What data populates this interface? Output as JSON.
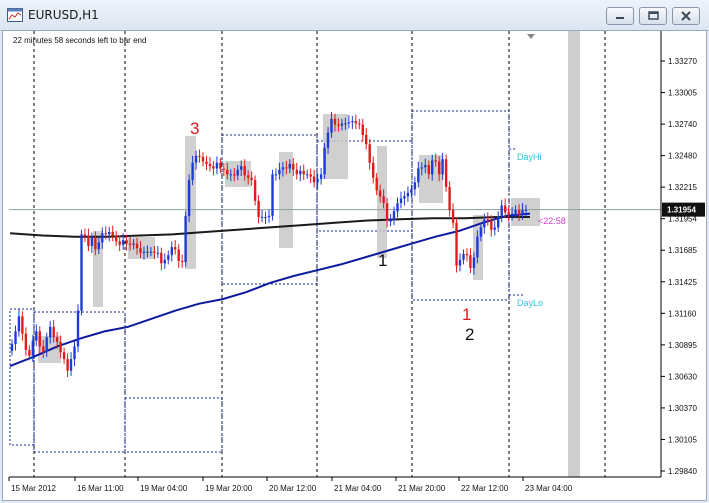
{
  "window": {
    "title": "EURUSD,H1",
    "icon": "chart-window-icon",
    "controls": [
      "minimize-icon",
      "restore-icon",
      "close-icon"
    ]
  },
  "chart_data": {
    "type": "candlestick",
    "symbol": "EURUSD",
    "timeframe": "H1",
    "info_text": "22 minutes 58 seconds left to bar end",
    "ylim": [
      1.2964,
      1.335
    ],
    "y_ticks": [
      "1.33270",
      "1.33005",
      "1.32740",
      "1.32480",
      "1.32215",
      "1.31954",
      "1.31685",
      "1.31425",
      "1.31160",
      "1.30895",
      "1.30630",
      "1.30370",
      "1.30105",
      "1.29840"
    ],
    "current_price": "1.31954",
    "x_ticks": [
      "15 Mar 2012",
      "16 Mar 11:00",
      "19 Mar 04:00",
      "19 Mar 20:00",
      "20 Mar 12:00",
      "21 Mar 04:00",
      "21 Mar 20:00",
      "22 Mar 12:00",
      "23 Mar 04:00"
    ],
    "labels": {
      "day_hi": "DayHi",
      "day_lo": "DayLo",
      "countdown": "<22:58",
      "wave_3": "3",
      "wave_1_black": "1",
      "wave_1_red": "1",
      "wave_2": "2"
    },
    "colors": {
      "bull": "#1f3ad8",
      "bear": "#e01b1b",
      "ma_fast": "#0c1a9e",
      "ma_slow": "#1a1a1a",
      "box": "#c8c8c8",
      "dayhilo": "#29c7de",
      "countdown": "#d23cd2",
      "price_line": "#8aa0a0"
    },
    "series": [
      {
        "name": "",
        "values": [
          1.3079,
          1.309,
          1.3103,
          1.3088,
          1.3074,
          1.3069,
          1.3082,
          1.309,
          1.3077,
          1.3072,
          1.3085,
          1.3094,
          1.3085,
          1.3081,
          1.3072,
          1.3066,
          1.3056,
          1.3066,
          1.3077,
          1.3108,
          1.3174,
          1.3173,
          1.3164,
          1.3171,
          1.3161,
          1.3167,
          1.3175,
          1.3174,
          1.3176,
          1.3173,
          1.3168,
          1.3165,
          1.3169,
          1.3166,
          1.3165,
          1.3166,
          1.3162,
          1.3158,
          1.3159,
          1.3159,
          1.3159,
          1.3158,
          1.3158,
          1.3149,
          1.3152,
          1.3156,
          1.3163,
          1.3161,
          1.3151,
          1.315,
          1.319,
          1.3221,
          1.3236,
          1.3242,
          1.3241,
          1.3237,
          1.3235,
          1.3233,
          1.3231,
          1.3236,
          1.3231,
          1.323,
          1.3226,
          1.3226,
          1.3225,
          1.323,
          1.3233,
          1.3225,
          1.3223,
          1.3221,
          1.3203,
          1.3189,
          1.3189,
          1.3189,
          1.319,
          1.3226,
          1.3226,
          1.323,
          1.3232,
          1.3231,
          1.3235,
          1.323,
          1.3226,
          1.3229,
          1.3226,
          1.3226,
          1.3224,
          1.3219,
          1.3222,
          1.3226,
          1.3249,
          1.3262,
          1.3274,
          1.3269,
          1.3268,
          1.327,
          1.327,
          1.3271,
          1.3272,
          1.327,
          1.3269,
          1.326,
          1.3252,
          1.3236,
          1.3223,
          1.3212,
          1.3207,
          1.3201,
          1.3186,
          1.3186,
          1.3194,
          1.3201,
          1.3205,
          1.3207,
          1.321,
          1.3213,
          1.3219,
          1.3231,
          1.3232,
          1.3234,
          1.3226,
          1.3238,
          1.3237,
          1.3226,
          1.3239,
          1.3215,
          1.3195,
          1.3184,
          1.3147,
          1.3152,
          1.3157,
          1.3156,
          1.3145,
          1.3154,
          1.3172,
          1.318,
          1.3187,
          1.3186,
          1.3178,
          1.318,
          1.319,
          1.3199,
          1.3193,
          1.3191,
          1.3192,
          1.3195,
          1.3191,
          1.3195,
          1.3195
        ]
      },
      {
        "name": "",
        "values": [
          1.306,
          1.3068,
          1.3077,
          1.3084,
          1.309,
          1.3094,
          1.3101,
          1.3108,
          1.3114,
          1.3118,
          1.3124,
          1.3132,
          1.3138,
          1.3143,
          1.3148,
          1.3154,
          1.316,
          1.3166,
          1.3172,
          1.3177,
          1.3184,
          1.319,
          1.3192
        ]
      },
      {
        "name": "",
        "values": [
          1.3175,
          1.3173,
          1.3172,
          1.3172,
          1.3173,
          1.3174,
          1.3176,
          1.3178,
          1.318,
          1.3182,
          1.3184,
          1.3186,
          1.3187,
          1.3188,
          1.3188,
          1.3189,
          1.3189
        ]
      }
    ]
  }
}
